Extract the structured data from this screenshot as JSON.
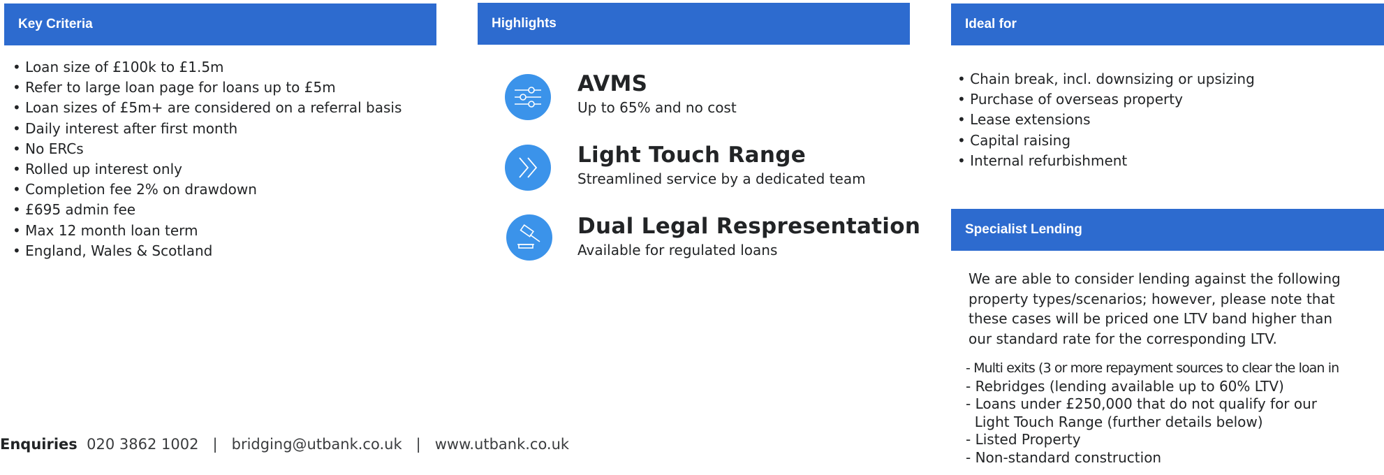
{
  "key_criteria": {
    "title": "Key Criteria",
    "items": [
      "Loan size of £100k to £1.5m",
      "Refer to large loan page for loans up to £5m",
      "Loan sizes of £5m+ are considered on a referral basis",
      "Daily interest after first month",
      "No ERCs",
      "Rolled up interest only",
      "Completion fee 2% on drawdown",
      "£695 admin fee",
      "Max 12 month loan term",
      "England, Wales & Scotland"
    ]
  },
  "highlights": {
    "title": "Highlights",
    "items": [
      {
        "icon": "sliders-icon",
        "title": "AVMS",
        "subtitle": "Up to 65% and no cost"
      },
      {
        "icon": "double-chevron-icon",
        "title": "Light Touch Range",
        "subtitle": "Streamlined service by a dedicated team"
      },
      {
        "icon": "gavel-icon",
        "title": "Dual Legal Respresentation",
        "subtitle": "Available for regulated loans"
      }
    ]
  },
  "ideal_for": {
    "title": "Ideal for",
    "items": [
      "Chain break, incl. downsizing or upsizing",
      "Purchase of overseas property",
      "Lease extensions",
      "Capital raising",
      "Internal refurbishment"
    ]
  },
  "specialist_lending": {
    "title": "Specialist Lending",
    "paragraph_lines": [
      "We are able to consider lending against the following",
      "property types/scenarios; however, please note that",
      "these cases will be priced one LTV band higher than",
      "our standard rate for the corresponding LTV."
    ],
    "items": [
      "Multi exits (3 or more repayment sources to clear the loan in",
      "Rebridges (lending available up to 60% LTV)",
      "Loans under £250,000 that do not qualify for our",
      "Light Touch Range (further details below)",
      "Listed Property",
      "Non-standard construction"
    ]
  },
  "footer": {
    "label": "Enquiries",
    "phone": "020 3862 1002",
    "separator": "|",
    "email": "bridging@utbank.co.uk",
    "website": "www.utbank.co.uk"
  },
  "colors": {
    "header_bar": "#2d6bcf",
    "icon_circle": "#3b93ea",
    "text": "#222426"
  }
}
